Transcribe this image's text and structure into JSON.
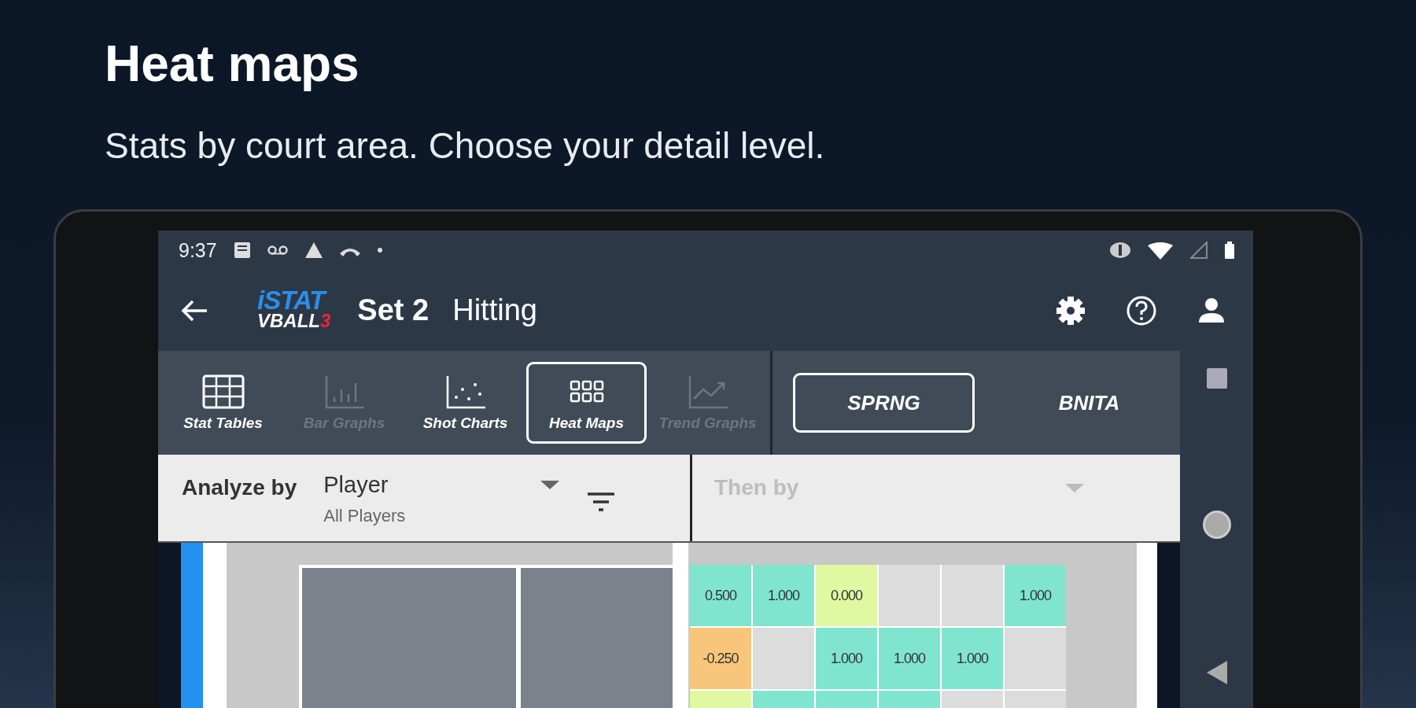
{
  "header": {
    "title": "Heat maps",
    "subtitle": "Stats by court area. Choose your detail level."
  },
  "status_bar": {
    "time": "9:37"
  },
  "app_bar": {
    "logo_top": "iSTAT",
    "logo_bottom": "VBALL",
    "logo_accent": "3",
    "set": "Set 2",
    "screen": "Hitting"
  },
  "view_tabs": [
    {
      "kind": "table",
      "label": "Stat Tables",
      "selected": false,
      "disabled": false
    },
    {
      "kind": "bars",
      "label": "Bar Graphs",
      "selected": false,
      "disabled": true
    },
    {
      "kind": "scatter",
      "label": "Shot Charts",
      "selected": false,
      "disabled": false
    },
    {
      "kind": "grid",
      "label": "Heat Maps",
      "selected": true,
      "disabled": false
    },
    {
      "kind": "trend",
      "label": "Trend Graphs",
      "selected": false,
      "disabled": true
    }
  ],
  "teams": [
    {
      "label": "SPRNG",
      "selected": true
    },
    {
      "label": "BNITA",
      "selected": false
    }
  ],
  "analyze": {
    "label": "Analyze by",
    "value": "Player",
    "detail": "All Players"
  },
  "then_by": {
    "placeholder": "Then by"
  },
  "heatmap": [
    [
      {
        "value": "0.500",
        "color": "#80e5cf"
      },
      {
        "value": "1.000",
        "color": "#80e5cf"
      },
      {
        "value": "0.000",
        "color": "#e0f8a2"
      },
      {
        "color": "#dcdcdc"
      },
      {
        "color": "#dcdcdc"
      },
      {
        "value": "1.000",
        "color": "#80e5cf"
      }
    ],
    [
      {
        "value": "-0.250",
        "color": "#f8c67a"
      },
      {
        "color": "#dcdcdc"
      },
      {
        "value": "1.000",
        "color": "#80e5cf"
      },
      {
        "value": "1.000",
        "color": "#80e5cf"
      },
      {
        "value": "1.000",
        "color": "#80e5cf"
      },
      {
        "color": "#dcdcdc"
      }
    ],
    [
      {
        "color": "#e0f8a2"
      },
      {
        "color": "#80e5cf"
      },
      {
        "color": "#80e5cf"
      },
      {
        "color": "#80e5cf"
      },
      {
        "color": "#dcdcdc"
      },
      {
        "color": "#dcdcdc"
      }
    ]
  ]
}
